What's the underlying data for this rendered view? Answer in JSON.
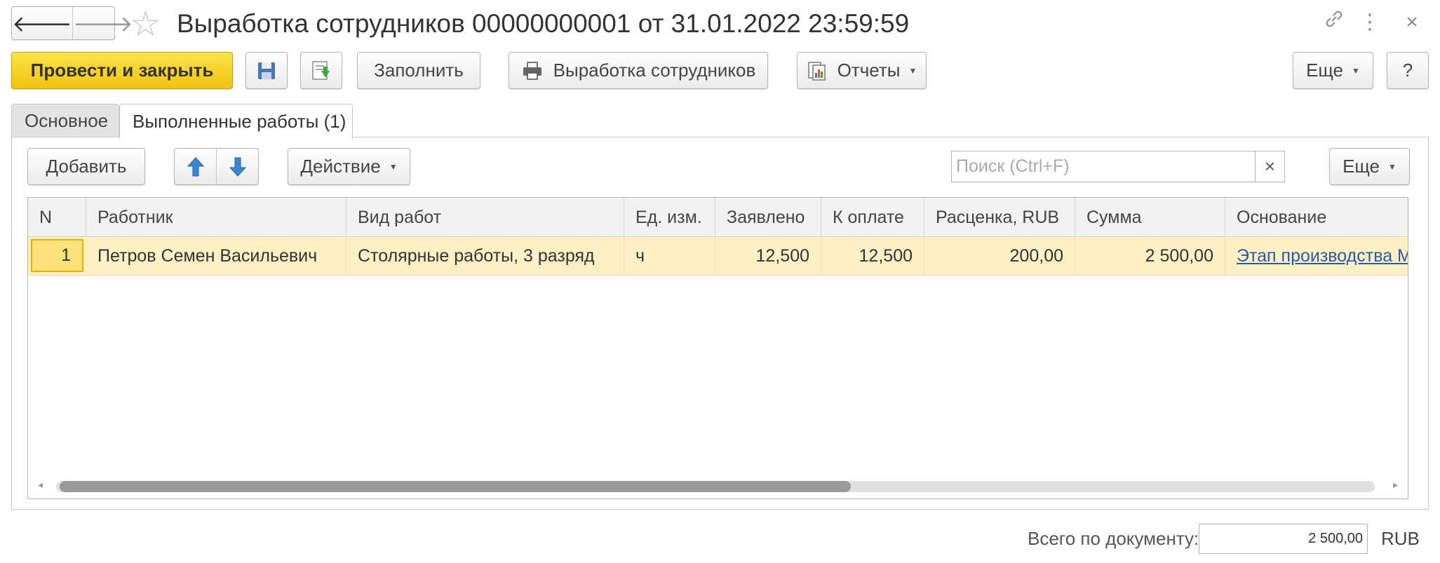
{
  "window": {
    "title": "Выработка сотрудников 00000000001 от 31.01.2022 23:59:59",
    "back_glyph": "🡐",
    "forward_glyph": "🡒",
    "star_glyph": "☆",
    "link_glyph": "🔗",
    "menu_glyph": "⋮",
    "close_glyph": "×"
  },
  "toolbar": {
    "post_close": "Провести и закрыть",
    "fill": "Заполнить",
    "print_employees": "Выработка сотрудников",
    "reports": "Отчеты",
    "more": "Еще",
    "help": "?"
  },
  "tabs": [
    {
      "label": "Основное",
      "active": false
    },
    {
      "label": "Выполненные работы (1)",
      "active": true
    }
  ],
  "table_toolbar": {
    "add": "Добавить",
    "action": "Действие",
    "more": "Еще",
    "search_placeholder": "Поиск (Ctrl+F)",
    "clear": "×"
  },
  "table": {
    "columns": [
      "N",
      "Работник",
      "Вид работ",
      "Ед. изм.",
      "Заявлено",
      "К оплате",
      "Расценка, RUB",
      "Сумма",
      "Основание"
    ],
    "rows": [
      {
        "n": "1",
        "employee": "Петров Семен Васильевич",
        "work_type": "Столярные работы, 3 разряд",
        "unit": "ч",
        "declared": "12,500",
        "to_pay": "12,500",
        "rate": "200,00",
        "sum": "2 500,00",
        "basis": "Этап производства М"
      }
    ],
    "scroll_position": 0.6
  },
  "footer": {
    "total_label": "Всего по документу:",
    "total_value": "2 500,00",
    "currency": "RUB"
  },
  "colors": {
    "primary_button": "#f5cf1d",
    "selected_row": "#fcf0c4",
    "link": "#2a5aa6"
  }
}
